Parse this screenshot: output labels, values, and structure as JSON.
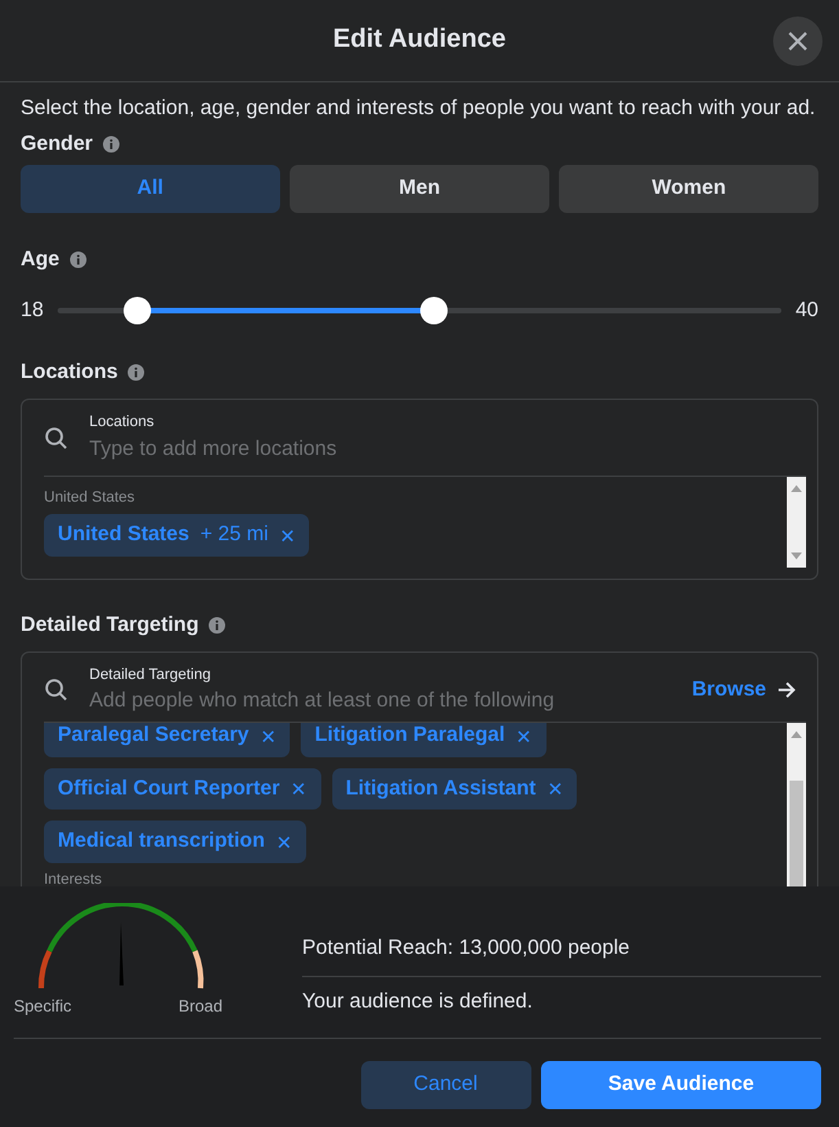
{
  "title": "Edit Audience",
  "intro": "Select the location, age, gender and interests of people you want to reach with your ad.",
  "gender": {
    "label": "Gender",
    "options": [
      {
        "label": "All",
        "selected": true
      },
      {
        "label": "Men",
        "selected": false
      },
      {
        "label": "Women",
        "selected": false
      }
    ]
  },
  "age": {
    "label": "Age",
    "min_reading": "18",
    "max_reading": "40",
    "low_thumb": {
      "level": 0.11
    },
    "high_thumb": {
      "level": 0.52
    }
  },
  "locations": {
    "label": "Locations",
    "field_label": "Locations",
    "placeholder": "Type to add more locations",
    "group_label": "United States",
    "tags": [
      {
        "label": "United States",
        "extra": "+ 25 mi",
        "remove": "✕"
      }
    ]
  },
  "detailed_targeting": {
    "label": "Detailed Targeting",
    "field_label": "Detailed Targeting",
    "placeholder": "Add people who match at least one of the following",
    "browse": "Browse",
    "tags": [
      {
        "label": "Paralegal Secretary",
        "remove": "✕"
      },
      {
        "label": "Litigation Paralegal",
        "remove": "✕"
      },
      {
        "label": "Official Court Reporter",
        "remove": "✕"
      },
      {
        "label": "Litigation Assistant",
        "remove": "✕"
      },
      {
        "label": "Medical transcription",
        "remove": "✕"
      }
    ],
    "next_group_label": "Interests"
  },
  "gauge": {
    "low_label": "Specific",
    "high_label": "Broad"
  },
  "reach": "Potential Reach: 13,000,000 people",
  "status": "Your audience is defined.",
  "buttons": [
    {
      "label": "Cancel",
      "kind": "secondary"
    },
    {
      "label": "Save Audience",
      "kind": "primary"
    }
  ]
}
